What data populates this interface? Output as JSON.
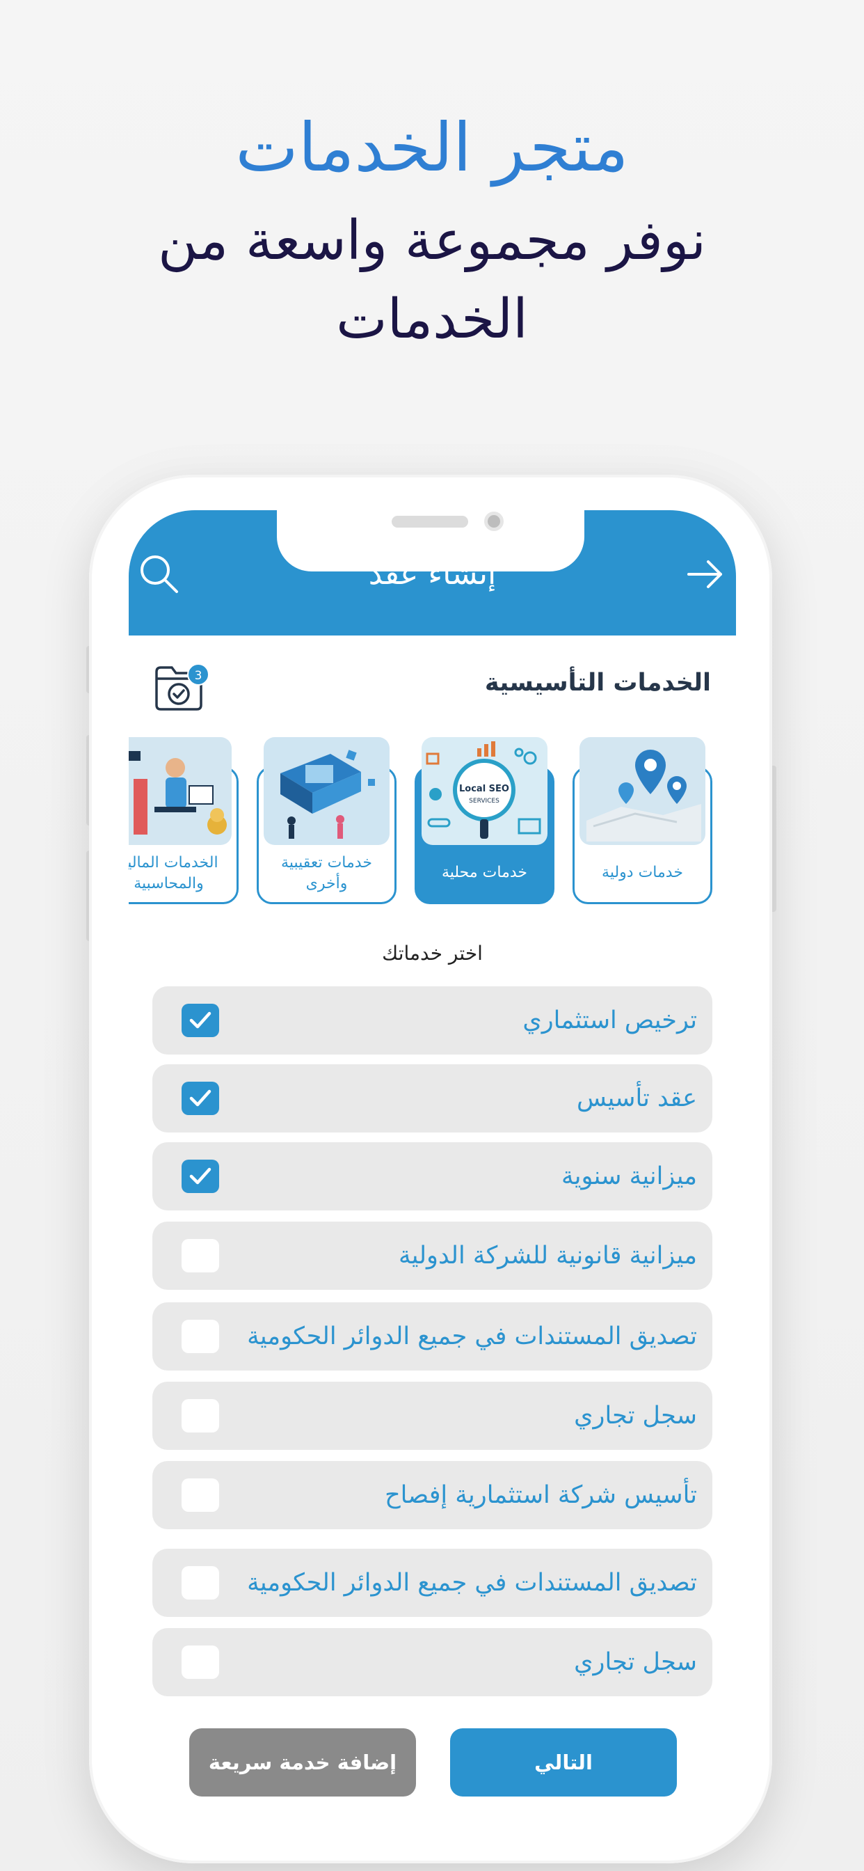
{
  "promo": {
    "title": "متجر الخدمات",
    "subtitle": "نوفر مجموعة واسعة من الخدمات"
  },
  "header": {
    "title": "إنشاء عقد",
    "search_icon": "search-icon",
    "back_icon": "arrow-right-icon"
  },
  "section": {
    "title": "الخدمات التأسيسية",
    "cart_count": "3",
    "cart_icon": "folder-check-icon"
  },
  "categories": [
    {
      "label": "خدمات دولية",
      "image": "map-pins-illustration",
      "active": false
    },
    {
      "label": "خدمات محلية",
      "image": "local-seo-illustration",
      "image_text": [
        "Local SEO",
        "SERVICES"
      ],
      "active": true
    },
    {
      "label": "خدمات تعقيبية وأخرى",
      "image": "technology-illustration",
      "active": false
    },
    {
      "label": "الخدمات المالية والمحاسبية",
      "image": "finance-illustration",
      "active": false
    }
  ],
  "services_heading": "اختر خدماتك",
  "services": [
    {
      "label": "ترخيص استثماري",
      "checked": true
    },
    {
      "label": "عقد تأسيس",
      "checked": true
    },
    {
      "label": "ميزانية سنوية",
      "checked": true
    },
    {
      "label": "ميزانية قانونية للشركة الدولية",
      "checked": false
    },
    {
      "label": "تصديق المستندات في جميع الدوائر الحكومية",
      "checked": false
    },
    {
      "label": "سجل تجاري",
      "checked": false
    },
    {
      "label": "تأسيس شركة استثمارية إفصاح",
      "checked": false
    },
    {
      "label": "تصديق المستندات في جميع الدوائر الحكومية",
      "checked": false
    },
    {
      "label": "سجل تجاري",
      "checked": false
    }
  ],
  "buttons": {
    "next": "التالي",
    "quick_add": "إضافة خدمة سريعة"
  },
  "colors": {
    "primary": "#2b93cf",
    "title_blue": "#2f7fd3",
    "subtitle_navy": "#1b1545",
    "item_bg": "#e9e9e9",
    "secondary_button": "#8a8a8a"
  }
}
